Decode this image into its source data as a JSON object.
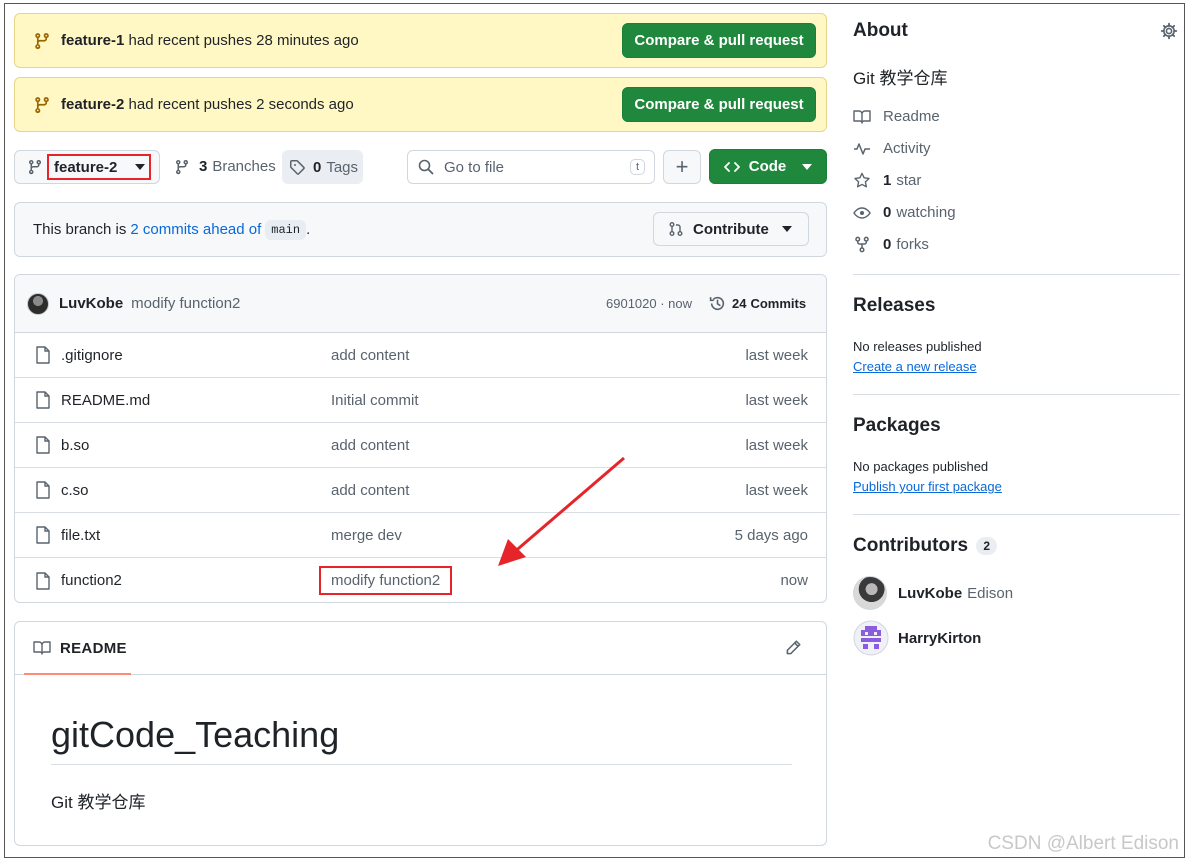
{
  "banners": [
    {
      "branch": "feature-1",
      "text": "had recent pushes 28 minutes ago",
      "button": "Compare & pull request"
    },
    {
      "branch": "feature-2",
      "text": "had recent pushes 2 seconds ago",
      "button": "Compare & pull request"
    }
  ],
  "toolbar": {
    "branch": "feature-2",
    "branches_count": "3",
    "branches_label": "Branches",
    "tags_count": "0",
    "tags_label": "Tags",
    "search_placeholder": "Go to file",
    "search_shortcut": "t",
    "add": "+",
    "code_label": "Code"
  },
  "ahead": {
    "prefix": "This branch is",
    "link": "2 commits ahead of",
    "base": "main",
    "suffix": ".",
    "contribute": "Contribute"
  },
  "commit": {
    "author": "LuvKobe",
    "message": "modify function2",
    "hash_time": "6901020 · now",
    "commits_count": "24",
    "commits_label": "Commits"
  },
  "files": [
    {
      "name": ".gitignore",
      "message": "add content",
      "time": "last week"
    },
    {
      "name": "README.md",
      "message": "Initial commit",
      "time": "last week"
    },
    {
      "name": "b.so",
      "message": "add content",
      "time": "last week"
    },
    {
      "name": "c.so",
      "message": "add content",
      "time": "last week"
    },
    {
      "name": "file.txt",
      "message": "merge dev",
      "time": "5 days ago"
    },
    {
      "name": "function2",
      "message": "modify function2",
      "time": "now"
    }
  ],
  "readme": {
    "tab": "README",
    "heading": "gitCode_Teaching",
    "description": "Git 教学仓库"
  },
  "about": {
    "title": "About",
    "description": "Git 教学仓库",
    "readme": "Readme",
    "activity": "Activity",
    "stars_count": "1",
    "stars_label": "star",
    "watching_count": "0",
    "watching_label": "watching",
    "forks_count": "0",
    "forks_label": "forks"
  },
  "releases": {
    "title": "Releases",
    "none": "No releases published",
    "link": "Create a new release"
  },
  "packages": {
    "title": "Packages",
    "none": "No packages published",
    "link": "Publish your first package"
  },
  "contributors": {
    "title": "Contributors",
    "count": "2",
    "list": [
      {
        "name": "LuvKobe",
        "extra": "Edison"
      },
      {
        "name": "HarryKirton",
        "extra": ""
      }
    ]
  },
  "watermark": "CSDN @Albert Edison",
  "colors": {
    "green": "#1f883d",
    "banner": "#fff8c5",
    "link": "#0969da",
    "annotation": "#e5252a"
  }
}
